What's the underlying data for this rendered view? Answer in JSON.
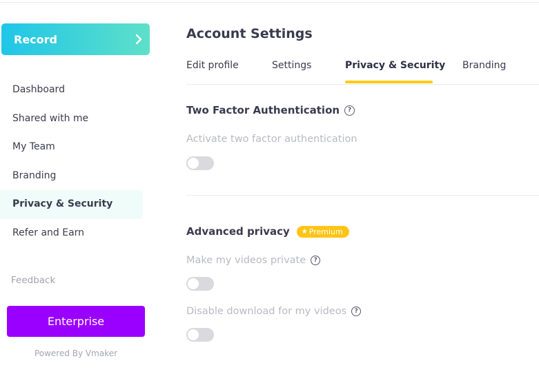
{
  "sidebar": {
    "record_label": "Record",
    "items": [
      {
        "label": "Dashboard"
      },
      {
        "label": "Shared with me"
      },
      {
        "label": "My Team"
      },
      {
        "label": "Branding"
      },
      {
        "label": "Privacy & Security"
      },
      {
        "label": "Refer and Earn"
      }
    ],
    "active_item": "Privacy & Security",
    "feedback_label": "Feedback",
    "enterprise_label": "Enterprise",
    "powered_by": "Powered By Vmaker"
  },
  "main": {
    "title": "Account Settings",
    "tabs": [
      {
        "label": "Edit profile"
      },
      {
        "label": "Settings"
      },
      {
        "label": "Privacy & Security"
      },
      {
        "label": "Branding"
      }
    ],
    "active_tab": "Privacy & Security",
    "two_factor": {
      "title": "Two Factor Authentication",
      "help_icon": "?",
      "activate_label": "Activate two factor authentication",
      "enabled": false
    },
    "advanced_privacy": {
      "title": "Advanced privacy",
      "badge_icon": "★",
      "badge_label": "Premium",
      "options": [
        {
          "label": "Make my videos private",
          "enabled": false
        },
        {
          "label": "Disable download for my videos",
          "enabled": false
        }
      ]
    }
  },
  "colors": {
    "record_gradient_start": "#1fc6e8",
    "record_gradient_end": "#5ee0c9",
    "enterprise": "#9a00ff",
    "active_tab_underline": "#ffca14",
    "premium_badge": "#ffc414",
    "active_nav_bg": "#effcfa"
  }
}
